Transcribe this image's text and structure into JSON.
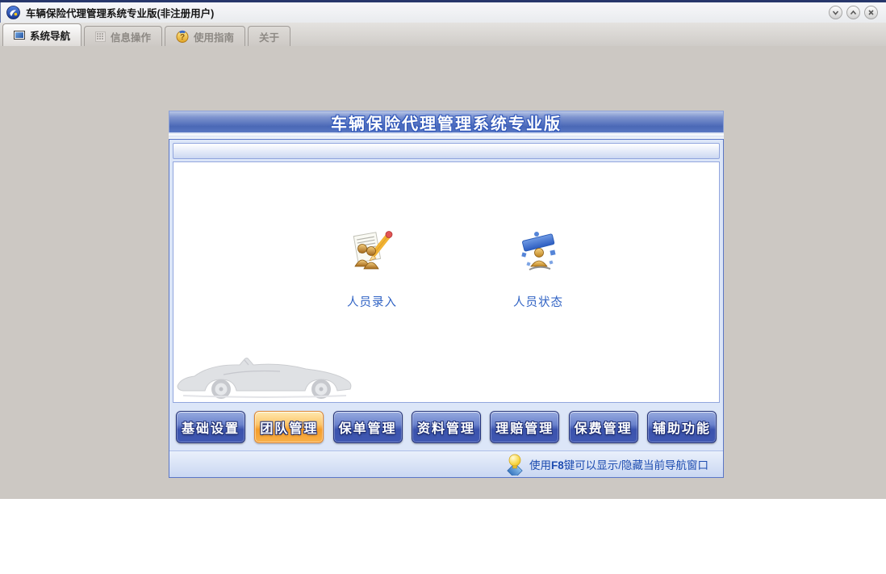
{
  "window": {
    "title": "车辆保险代理管理系统专业版(非注册用户)",
    "app_icon": "app-logo-icon",
    "controls": [
      {
        "name": "minimize-button",
        "icon": "chevron-down-icon"
      },
      {
        "name": "maximize-button",
        "icon": "chevron-up-icon"
      },
      {
        "name": "close-button",
        "icon": "close-icon"
      }
    ]
  },
  "tabs": [
    {
      "label": "系统导航",
      "icon": "monitor-icon",
      "active": true
    },
    {
      "label": "信息操作",
      "icon": "grid-icon",
      "active": false
    },
    {
      "label": "使用指南",
      "icon": "help-icon",
      "active": false
    },
    {
      "label": "关于",
      "icon": null,
      "active": false
    }
  ],
  "panel": {
    "title": "车辆保险代理管理系统专业版",
    "shortcuts": [
      {
        "label": "人员录入",
        "icon": "personnel-entry-icon"
      },
      {
        "label": "人员状态",
        "icon": "personnel-status-icon"
      }
    ],
    "nav_buttons": [
      {
        "label": "基础设置",
        "active": false
      },
      {
        "label": "团队管理",
        "active": true
      },
      {
        "label": "保单管理",
        "active": false
      },
      {
        "label": "资料管理",
        "active": false
      },
      {
        "label": "理赔管理",
        "active": false
      },
      {
        "label": "保费管理",
        "active": false
      },
      {
        "label": "辅助功能",
        "active": false
      }
    ],
    "status_tip": {
      "prefix": "使用",
      "key": "F8",
      "suffix": "键可以显示/隐藏当前导航窗口",
      "icon": "bulb-icon"
    },
    "watermark": "sports-car-image"
  },
  "colors": {
    "client_background": "#ccc8c3",
    "header_blue": "#4a68b6",
    "button_blue": "#3b53ad",
    "active_button_orange": "#f59d2a",
    "shortcut_link_blue": "#2f62c4",
    "status_text_blue": "#1d4cb0"
  }
}
